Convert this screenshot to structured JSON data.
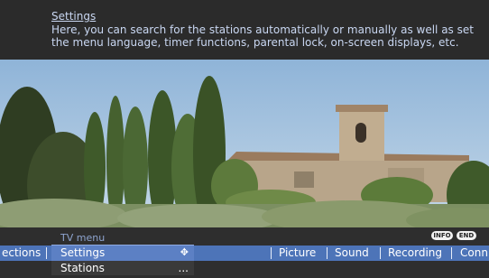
{
  "info": {
    "title": "Settings",
    "description": "Here, you can search for the stations automatically or manually as well as set the menu language, timer functions, parental lock, on-screen displays, etc."
  },
  "badges": {
    "info": "INFO",
    "end": "END"
  },
  "menu": {
    "header": "TV menu",
    "selected": "Settings",
    "selected_icon": "move-arrows-icon",
    "next": "Stations",
    "next_more": "..."
  },
  "menubar": {
    "items": [
      "ections",
      "Picture",
      "Sound",
      "Recording",
      "Conn"
    ]
  },
  "colors": {
    "menubar": "#4d74b8",
    "selected": "#5c80c4",
    "text_info": "#c9d7f2"
  }
}
